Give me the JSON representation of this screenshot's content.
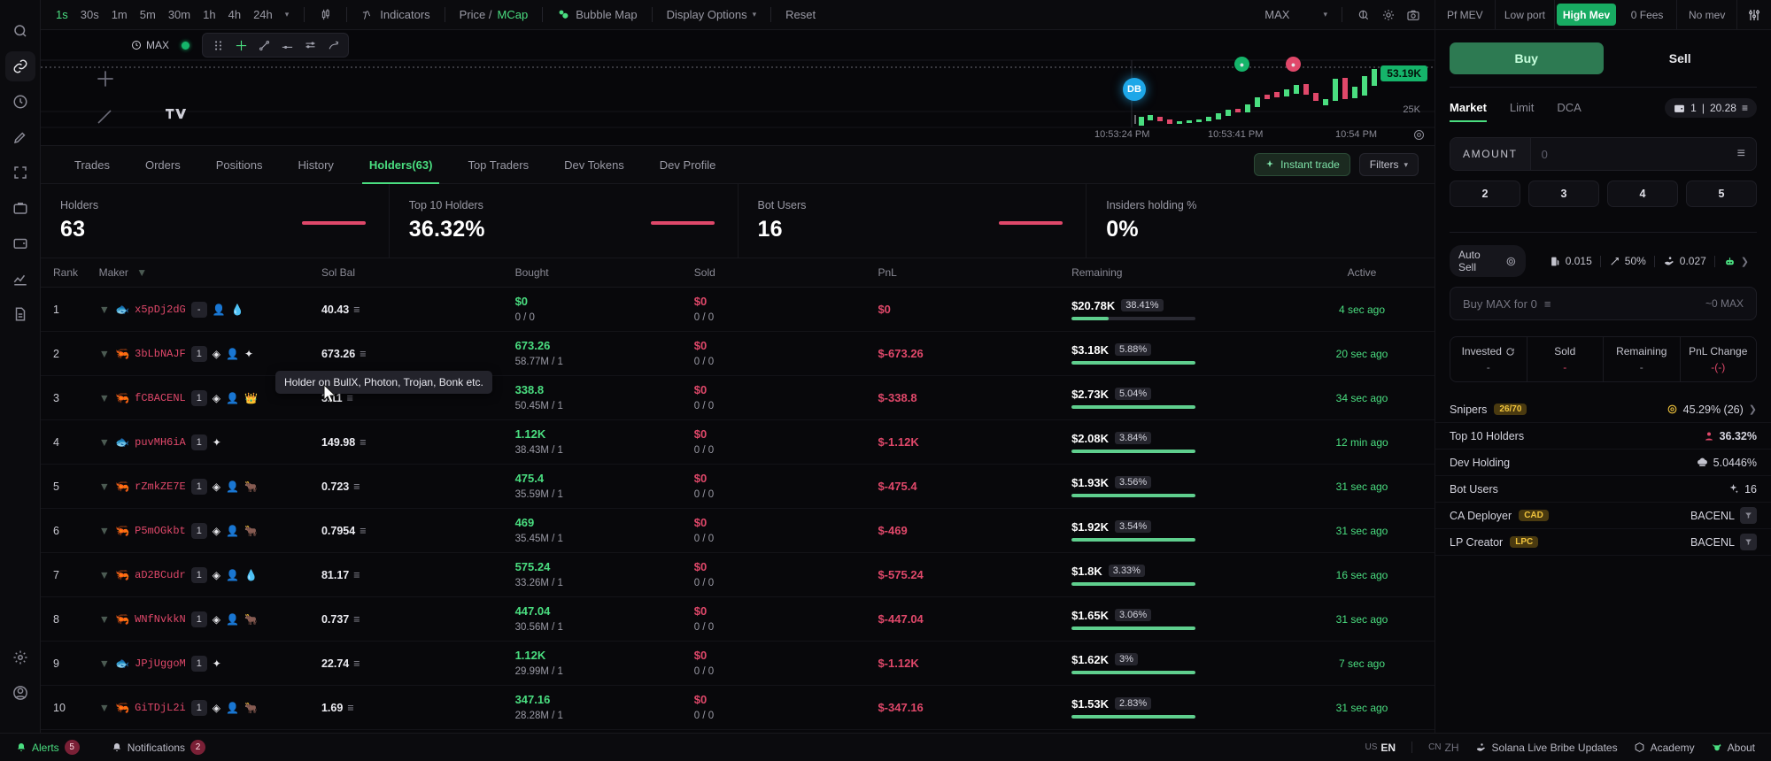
{
  "toolbar": {
    "timeframes": [
      {
        "label": "1s",
        "active": true
      },
      {
        "label": "30s",
        "active": false
      },
      {
        "label": "1m",
        "active": false
      },
      {
        "label": "5m",
        "active": false
      },
      {
        "label": "30m",
        "active": false
      },
      {
        "label": "1h",
        "active": false
      },
      {
        "label": "4h",
        "active": false
      },
      {
        "label": "24h",
        "active": false
      }
    ],
    "indicators_label": "Indicators",
    "price_label": "Price /",
    "mcap_label": "MCap",
    "bubble_map_label": "Bubble Map",
    "display_options_label": "Display Options",
    "reset_label": "Reset",
    "range_label": "MAX"
  },
  "chart": {
    "max_label": "MAX",
    "price_tag": "53.19K",
    "axis_label": "25K",
    "time_labels": [
      "10:53:24 PM",
      "10:53:41 PM",
      "10:54 PM"
    ],
    "marker_db": "DB"
  },
  "tabs": [
    {
      "label": "Trades",
      "active": false
    },
    {
      "label": "Orders",
      "active": false
    },
    {
      "label": "Positions",
      "active": false
    },
    {
      "label": "History",
      "active": false
    },
    {
      "label": "Holders(63)",
      "active": true
    },
    {
      "label": "Top Traders",
      "active": false
    },
    {
      "label": "Dev Tokens",
      "active": false
    },
    {
      "label": "Dev Profile",
      "active": false
    }
  ],
  "tabs_right": {
    "instant_trade": "Instant trade",
    "filters": "Filters"
  },
  "stats": [
    {
      "label": "Holders",
      "value": "63"
    },
    {
      "label": "Top 10 Holders",
      "value": "36.32%"
    },
    {
      "label": "Bot Users",
      "value": "16"
    },
    {
      "label": "Insiders holding %",
      "value": "0%"
    }
  ],
  "table": {
    "headers": [
      "Rank",
      "Maker",
      "Sol Bal",
      "Bought",
      "Sold",
      "PnL",
      "Remaining",
      "Active"
    ],
    "tooltip": "Holder on BullX, Photon, Trojan, Bonk etc.",
    "rows": [
      {
        "rank": "1",
        "fish": "🐟",
        "address": "x5pDj2dG",
        "badge": "-",
        "icons": [
          "👤",
          "💧"
        ],
        "sol": "40.43",
        "bought": "$0",
        "bought_sub": "0 / 0",
        "bought_green": false,
        "sold": "$0",
        "sold_sub": "0 / 0",
        "pnl": "$0",
        "remaining": "$20.78K",
        "rem_pct": "38.41%",
        "bar": 30,
        "active": "4 sec ago"
      },
      {
        "rank": "2",
        "fish": "🦐",
        "address": "3bLbNAJF",
        "badge": "1",
        "icons": [
          "◈",
          "👤",
          "✦"
        ],
        "sol": "673.26",
        "bought": "673.26",
        "bought_sub": "58.77M / 1",
        "bought_green": true,
        "sold": "$0",
        "sold_sub": "0 / 0",
        "pnl": "$-673.26",
        "remaining": "$3.18K",
        "rem_pct": "5.88%",
        "bar": 100,
        "active": "20 sec ago"
      },
      {
        "rank": "3",
        "fish": "🦐",
        "address": "fCBACENL",
        "badge": "1",
        "icons": [
          "◈",
          "👤",
          "👑"
        ],
        "sol": "3.11",
        "bought": "338.8",
        "bought_sub": "50.45M / 1",
        "bought_green": true,
        "sold": "$0",
        "sold_sub": "0 / 0",
        "pnl": "$-338.8",
        "remaining": "$2.73K",
        "rem_pct": "5.04%",
        "bar": 100,
        "active": "34 sec ago"
      },
      {
        "rank": "4",
        "fish": "🐟",
        "address": "puvMH6iA",
        "badge": "1",
        "icons": [
          "✦"
        ],
        "sol": "149.98",
        "bought": "1.12K",
        "bought_sub": "38.43M / 1",
        "bought_green": true,
        "sold": "$0",
        "sold_sub": "0 / 0",
        "pnl": "$-1.12K",
        "remaining": "$2.08K",
        "rem_pct": "3.84%",
        "bar": 100,
        "active": "12 min ago"
      },
      {
        "rank": "5",
        "fish": "🦐",
        "address": "rZmkZE7E",
        "badge": "1",
        "icons": [
          "◈",
          "👤",
          "🐂"
        ],
        "sol": "0.723",
        "bought": "475.4",
        "bought_sub": "35.59M / 1",
        "bought_green": true,
        "sold": "$0",
        "sold_sub": "0 / 0",
        "pnl": "$-475.4",
        "remaining": "$1.93K",
        "rem_pct": "3.56%",
        "bar": 100,
        "active": "31 sec ago"
      },
      {
        "rank": "6",
        "fish": "🦐",
        "address": "P5mOGkbt",
        "badge": "1",
        "icons": [
          "◈",
          "👤",
          "🐂"
        ],
        "sol": "0.7954",
        "bought": "469",
        "bought_sub": "35.45M / 1",
        "bought_green": true,
        "sold": "$0",
        "sold_sub": "0 / 0",
        "pnl": "$-469",
        "remaining": "$1.92K",
        "rem_pct": "3.54%",
        "bar": 100,
        "active": "31 sec ago"
      },
      {
        "rank": "7",
        "fish": "🦐",
        "address": "aD2BCudr",
        "badge": "1",
        "icons": [
          "◈",
          "👤",
          "💧"
        ],
        "sol": "81.17",
        "bought": "575.24",
        "bought_sub": "33.26M / 1",
        "bought_green": true,
        "sold": "$0",
        "sold_sub": "0 / 0",
        "pnl": "$-575.24",
        "remaining": "$1.8K",
        "rem_pct": "3.33%",
        "bar": 100,
        "active": "16 sec ago"
      },
      {
        "rank": "8",
        "fish": "🦐",
        "address": "WNfNvkkN",
        "badge": "1",
        "icons": [
          "◈",
          "👤",
          "🐂"
        ],
        "sol": "0.737",
        "bought": "447.04",
        "bought_sub": "30.56M / 1",
        "bought_green": true,
        "sold": "$0",
        "sold_sub": "0 / 0",
        "pnl": "$-447.04",
        "remaining": "$1.65K",
        "rem_pct": "3.06%",
        "bar": 100,
        "active": "31 sec ago"
      },
      {
        "rank": "9",
        "fish": "🐟",
        "address": "JPjUggoM",
        "badge": "1",
        "icons": [
          "✦"
        ],
        "sol": "22.74",
        "bought": "1.12K",
        "bought_sub": "29.99M / 1",
        "bought_green": true,
        "sold": "$0",
        "sold_sub": "0 / 0",
        "pnl": "$-1.12K",
        "remaining": "$1.62K",
        "rem_pct": "3%",
        "bar": 100,
        "active": "7 sec ago"
      },
      {
        "rank": "10",
        "fish": "🦐",
        "address": "GiTDjL2i",
        "badge": "1",
        "icons": [
          "◈",
          "👤",
          "🐂"
        ],
        "sol": "1.69",
        "bought": "347.16",
        "bought_sub": "28.28M / 1",
        "bought_green": true,
        "sold": "$0",
        "sold_sub": "0 / 0",
        "pnl": "$-347.16",
        "remaining": "$1.53K",
        "rem_pct": "2.83%",
        "bar": 100,
        "active": "31 sec ago"
      }
    ]
  },
  "mev_bar": [
    {
      "label": "Pf MEV",
      "active": false
    },
    {
      "label": "Low port",
      "active": false
    },
    {
      "label": "High Mev",
      "active": true
    },
    {
      "label": "0 Fees",
      "active": false
    },
    {
      "label": "No mev",
      "active": false
    }
  ],
  "trade": {
    "buy_label": "Buy",
    "sell_label": "Sell",
    "order_tabs": [
      {
        "label": "Market",
        "active": true
      },
      {
        "label": "Limit",
        "active": false
      },
      {
        "label": "DCA",
        "active": false
      }
    ],
    "wallet_count": "1",
    "wallet_balance": "20.28",
    "amount_label": "AMOUNT",
    "amount_value": "",
    "amount_placeholder": "0",
    "presets": [
      "2",
      "3",
      "4",
      "5"
    ],
    "auto_sell_label": "Auto Sell",
    "gas_value": "0.015",
    "slippage_value": "50%",
    "tip_value": "0.027",
    "buy_max_label": "Buy MAX for 0",
    "buy_max_right": "~0 MAX"
  },
  "pnl_panel": [
    {
      "label": "Invested",
      "value": "-",
      "red": false
    },
    {
      "label": "Sold",
      "value": "-",
      "red": true
    },
    {
      "label": "Remaining",
      "value": "-",
      "red": false
    },
    {
      "label": "PnL Change",
      "value": "-(-)",
      "red": true
    }
  ],
  "info_rows": [
    {
      "label": "Snipers",
      "tag": "26/70",
      "value": "45.29% (26)",
      "icon": "target-icon",
      "chevron": true,
      "red": false
    },
    {
      "label": "Top 10 Holders",
      "tag": "",
      "value": "36.32%",
      "icon": "person-icon",
      "chevron": false,
      "red": true
    },
    {
      "label": "Dev Holding",
      "tag": "",
      "value": "5.0446%",
      "icon": "chef-icon",
      "chevron": false,
      "red": false
    },
    {
      "label": "Bot Users",
      "tag": "",
      "value": "16",
      "icon": "sparkle-icon",
      "chevron": false,
      "red": false
    },
    {
      "label": "CA Deployer",
      "tag": "CAD",
      "value": "BACENL",
      "icon": "filter-icon",
      "chevron": false,
      "red": false
    },
    {
      "label": "LP Creator",
      "tag": "LPC",
      "value": "BACENL",
      "icon": "filter-icon",
      "chevron": false,
      "red": false
    }
  ],
  "status_bar": {
    "alerts_label": "Alerts",
    "alerts_count": "5",
    "notifications_label": "Notifications",
    "notifications_count": "2",
    "lang_us": "US",
    "lang_en": "EN",
    "lang_cn": "CN",
    "lang_zh": "ZH",
    "bribe_label": "Solana Live Bribe Updates",
    "academy_label": "Academy",
    "about_label": "About"
  },
  "colors": {
    "accent_green": "#4ade80",
    "accent_red": "#e0486a",
    "brand_blue": "#1ea7e8",
    "amber": "#f0c33c"
  },
  "chart_data": {
    "type": "candlestick",
    "title": "",
    "xlabel": "",
    "ylabel": "",
    "x_ticks": [
      "10:53:24 PM",
      "10:53:41 PM",
      "10:54 PM"
    ],
    "y_ticks": [
      "25K",
      "53.19K"
    ],
    "last_price": "53.19K",
    "candles": [
      {
        "o": 8,
        "c": 9,
        "h": 12,
        "l": 4,
        "up": true
      },
      {
        "o": 9,
        "c": 13,
        "h": 14,
        "l": 8,
        "up": true
      },
      {
        "o": 13,
        "c": 11,
        "h": 14,
        "l": 10,
        "up": false
      },
      {
        "o": 11,
        "c": 10,
        "h": 12,
        "l": 9,
        "up": false
      },
      {
        "o": 10,
        "c": 11,
        "h": 12,
        "l": 9,
        "up": true
      },
      {
        "o": 11,
        "c": 12,
        "h": 13,
        "l": 10,
        "up": true
      },
      {
        "o": 12,
        "c": 14,
        "h": 15,
        "l": 11,
        "up": true
      },
      {
        "o": 14,
        "c": 18,
        "h": 19,
        "l": 13,
        "up": true
      },
      {
        "o": 18,
        "c": 22,
        "h": 23,
        "l": 17,
        "up": true
      },
      {
        "o": 22,
        "c": 28,
        "h": 30,
        "l": 21,
        "up": true
      },
      {
        "o": 28,
        "c": 36,
        "h": 38,
        "l": 27,
        "up": true
      },
      {
        "o": 36,
        "c": 42,
        "h": 44,
        "l": 35,
        "up": true
      },
      {
        "o": 42,
        "c": 40,
        "h": 45,
        "l": 39,
        "up": false
      },
      {
        "o": 40,
        "c": 47,
        "h": 49,
        "l": 39,
        "up": true
      },
      {
        "o": 47,
        "c": 44,
        "h": 50,
        "l": 43,
        "up": false
      },
      {
        "o": 44,
        "c": 52,
        "h": 55,
        "l": 43,
        "up": true
      },
      {
        "o": 52,
        "c": 48,
        "h": 56,
        "l": 47,
        "up": false
      },
      {
        "o": 48,
        "c": 42,
        "h": 50,
        "l": 41,
        "up": false
      },
      {
        "o": 42,
        "c": 60,
        "h": 64,
        "l": 41,
        "up": true
      },
      {
        "o": 60,
        "c": 55,
        "h": 66,
        "l": 53,
        "up": false
      },
      {
        "o": 55,
        "c": 58,
        "h": 62,
        "l": 53,
        "up": true
      },
      {
        "o": 58,
        "c": 70,
        "h": 74,
        "l": 57,
        "up": true
      }
    ]
  }
}
